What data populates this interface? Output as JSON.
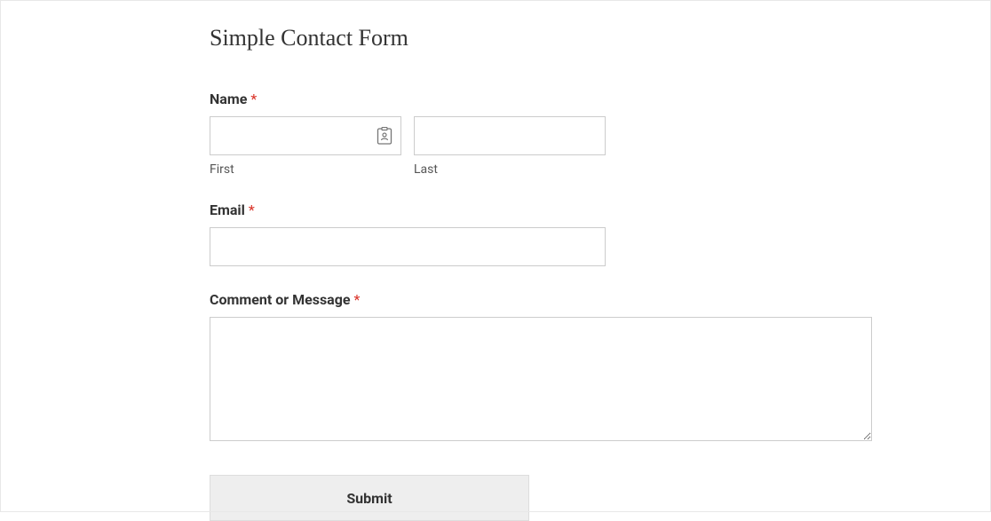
{
  "form": {
    "title": "Simple Contact Form",
    "required_mark": "*",
    "name": {
      "label": "Name",
      "first_sublabel": "First",
      "last_sublabel": "Last",
      "first_value": "",
      "last_value": ""
    },
    "email": {
      "label": "Email",
      "value": ""
    },
    "message": {
      "label": "Comment or Message",
      "value": ""
    },
    "submit_label": "Submit"
  }
}
